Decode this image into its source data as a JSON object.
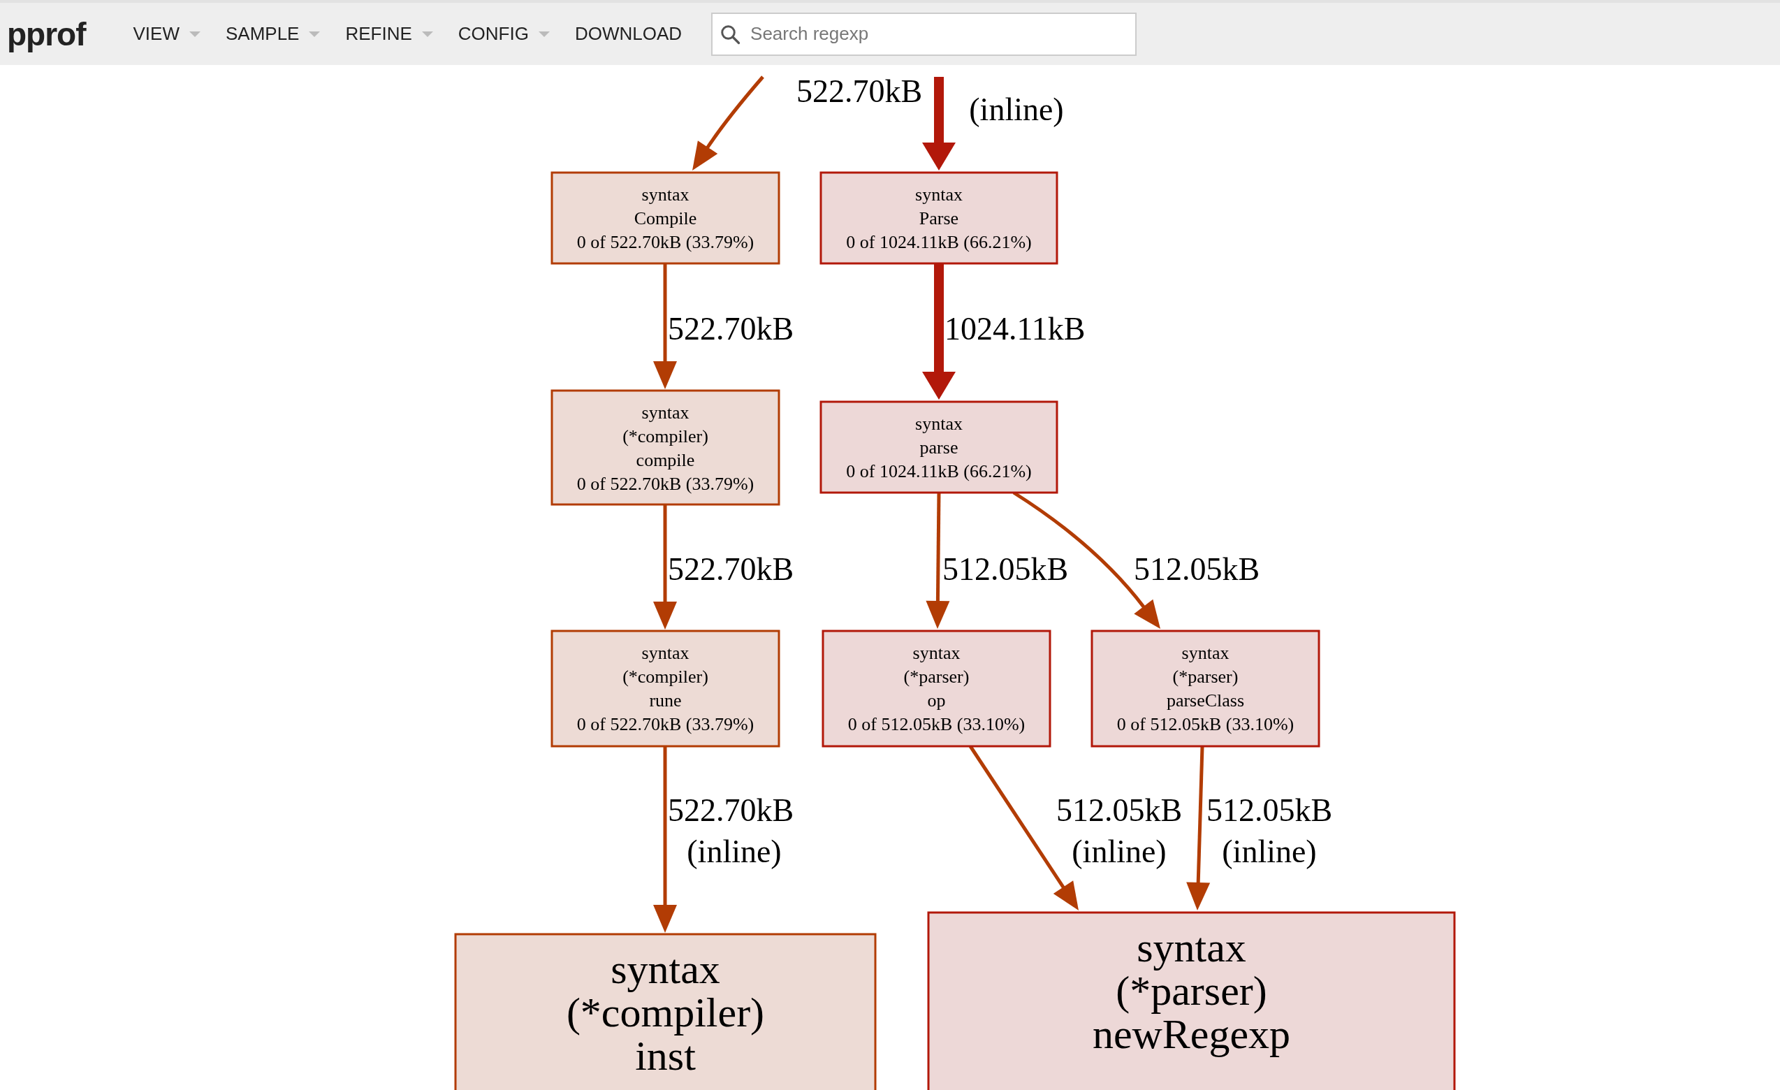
{
  "header": {
    "logo": "pprof",
    "menu": [
      {
        "label": "VIEW",
        "dropdown": true
      },
      {
        "label": "SAMPLE",
        "dropdown": true
      },
      {
        "label": "REFINE",
        "dropdown": true
      },
      {
        "label": "CONFIG",
        "dropdown": true
      },
      {
        "label": "DOWNLOAD",
        "dropdown": false
      }
    ],
    "search": {
      "placeholder": "Search regexp"
    }
  },
  "graph": {
    "nodes": [
      {
        "kind": "small",
        "lines": [
          "syntax",
          "Compile",
          "0 of 522.70kB (33.79%)"
        ]
      },
      {
        "kind": "small",
        "lines": [
          "syntax",
          "Parse",
          "0 of 1024.11kB (66.21%)"
        ]
      },
      {
        "kind": "small",
        "lines": [
          "syntax",
          "(*compiler)",
          "compile",
          "0 of 522.70kB (33.79%)"
        ]
      },
      {
        "kind": "small",
        "lines": [
          "syntax",
          "parse",
          "0 of 1024.11kB (66.21%)"
        ]
      },
      {
        "kind": "small",
        "lines": [
          "syntax",
          "(*compiler)",
          "rune",
          "0 of 522.70kB (33.79%)"
        ]
      },
      {
        "kind": "small",
        "lines": [
          "syntax",
          "(*parser)",
          "op",
          "0 of 512.05kB (33.10%)"
        ]
      },
      {
        "kind": "small",
        "lines": [
          "syntax",
          "(*parser)",
          "parseClass",
          "0 of 512.05kB (33.10%)"
        ]
      },
      {
        "kind": "large",
        "lines": [
          "syntax",
          "(*compiler)",
          "inst"
        ]
      },
      {
        "kind": "large",
        "lines": [
          "syntax",
          "(*parser)",
          "newRegexp"
        ]
      }
    ],
    "edges": [
      {
        "kind": "normal",
        "labels": [
          "522.70kB"
        ]
      },
      {
        "kind": "heavy",
        "labels": [
          "(inline)"
        ]
      },
      {
        "kind": "normal",
        "labels": [
          "522.70kB"
        ]
      },
      {
        "kind": "heavy",
        "labels": [
          "1024.11kB"
        ]
      },
      {
        "kind": "normal",
        "labels": [
          "522.70kB"
        ]
      },
      {
        "kind": "normal",
        "labels": [
          "512.05kB"
        ]
      },
      {
        "kind": "normal",
        "labels": [
          "512.05kB"
        ]
      },
      {
        "kind": "normal",
        "labels": [
          "522.70kB",
          "(inline)"
        ]
      },
      {
        "kind": "normal",
        "labels": [
          "512.05kB",
          "(inline)"
        ]
      },
      {
        "kind": "normal",
        "labels": [
          "512.05kB",
          "(inline)"
        ]
      }
    ]
  }
}
